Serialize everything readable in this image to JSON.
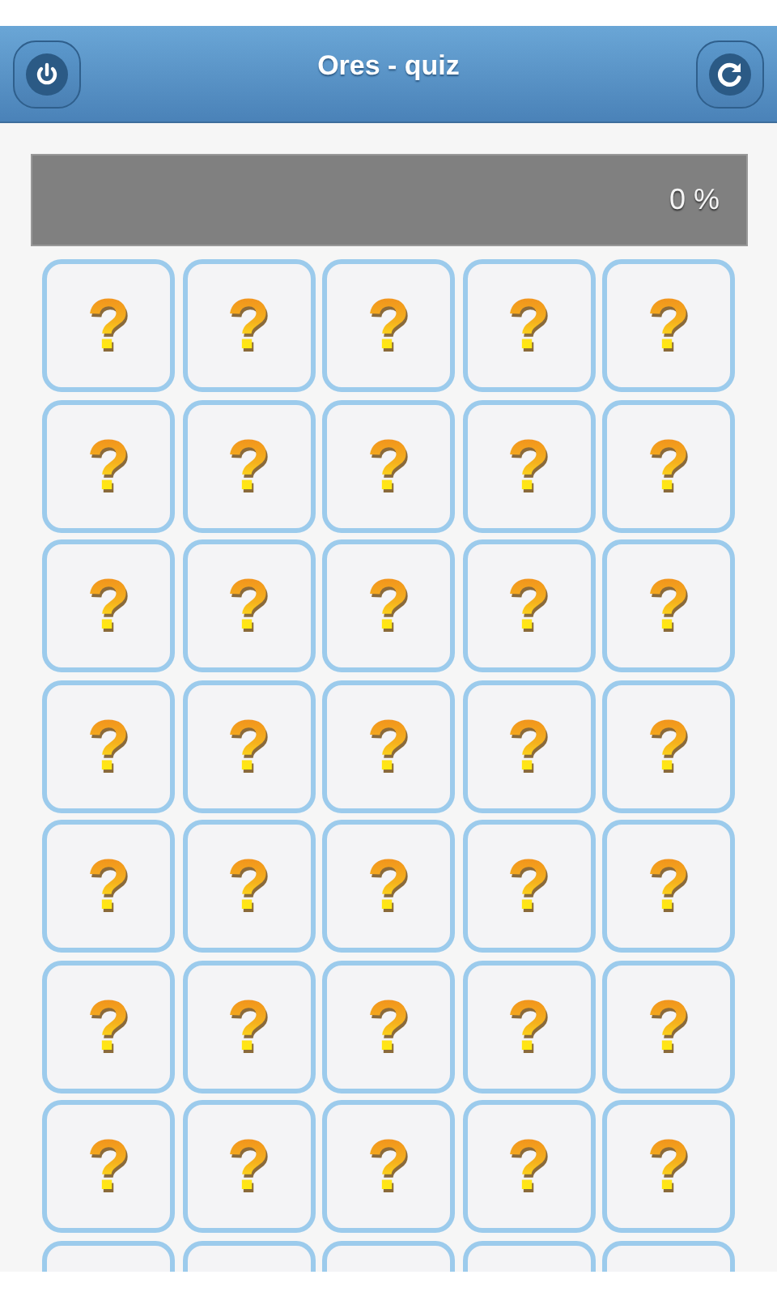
{
  "header": {
    "title": "Ores - quiz"
  },
  "progress": {
    "level": 0,
    "reading": "0 %"
  },
  "rows": [
    [
      {
        "symbol": "?"
      },
      {
        "symbol": "?"
      },
      {
        "symbol": "?"
      },
      {
        "symbol": "?"
      },
      {
        "symbol": "?"
      }
    ],
    [
      {
        "symbol": "?"
      },
      {
        "symbol": "?"
      },
      {
        "symbol": "?"
      },
      {
        "symbol": "?"
      },
      {
        "symbol": "?"
      }
    ],
    [
      {
        "symbol": "?"
      },
      {
        "symbol": "?"
      },
      {
        "symbol": "?"
      },
      {
        "symbol": "?"
      },
      {
        "symbol": "?"
      }
    ],
    [
      {
        "symbol": "?"
      },
      {
        "symbol": "?"
      },
      {
        "symbol": "?"
      },
      {
        "symbol": "?"
      },
      {
        "symbol": "?"
      }
    ],
    [
      {
        "symbol": "?"
      },
      {
        "symbol": "?"
      },
      {
        "symbol": "?"
      },
      {
        "symbol": "?"
      },
      {
        "symbol": "?"
      }
    ],
    [
      {
        "symbol": "?"
      },
      {
        "symbol": "?"
      },
      {
        "symbol": "?"
      },
      {
        "symbol": "?"
      },
      {
        "symbol": "?"
      }
    ],
    [
      {
        "symbol": "?"
      },
      {
        "symbol": "?"
      },
      {
        "symbol": "?"
      },
      {
        "symbol": "?"
      },
      {
        "symbol": "?"
      }
    ]
  ]
}
